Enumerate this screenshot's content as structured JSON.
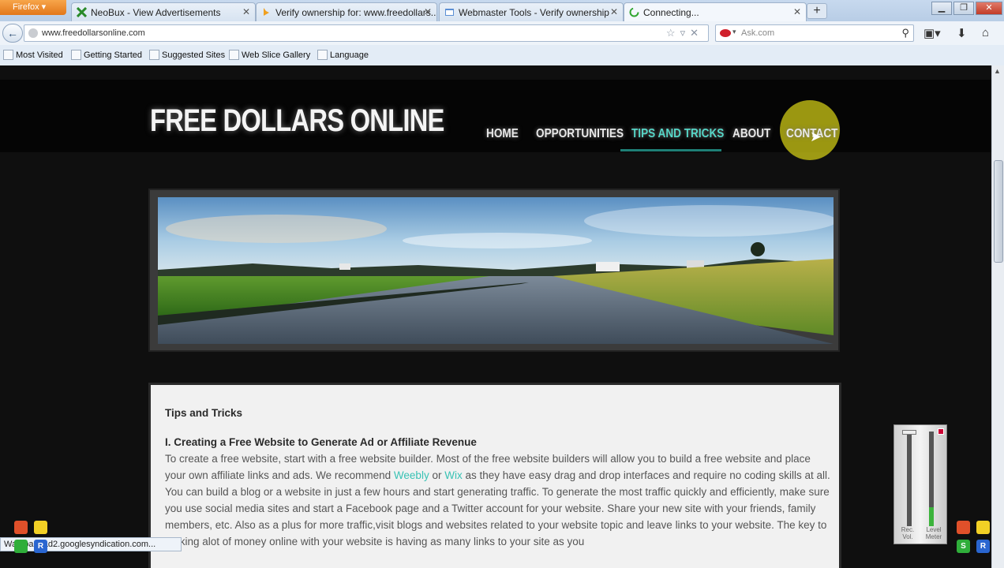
{
  "browser": {
    "app_button": "Firefox",
    "tabs": [
      {
        "title": "NeoBux - View Advertisements",
        "icon": "neobux-icon",
        "active": false
      },
      {
        "title": "Verify ownership for: www.freedollars...",
        "icon": "bing-icon",
        "active": false
      },
      {
        "title": "Webmaster Tools - Verify ownership",
        "icon": "webmaster-icon",
        "active": false
      },
      {
        "title": "Connecting...",
        "icon": "loading-icon",
        "active": true
      }
    ],
    "new_tab": "+",
    "url": "www.freedollarsonline.com",
    "search_placeholder": "Ask.com",
    "bookmarks": [
      "Most Visited",
      "Getting Started",
      "Suggested Sites",
      "Web Slice Gallery",
      "Language"
    ],
    "status_text": "Wa...pagead2.googlesyndication.com..."
  },
  "site": {
    "title": "FREE DOLLARS ONLINE",
    "nav": [
      {
        "label": "HOME",
        "active": false
      },
      {
        "label": "OPPORTUNITIES",
        "active": false
      },
      {
        "label": "TIPS AND TRICKS",
        "active": true
      },
      {
        "label": "ABOUT",
        "active": false
      },
      {
        "label": "CONTACT",
        "active": false
      }
    ],
    "accent_color": "#56d6c7",
    "content": {
      "heading": "Tips and Tricks",
      "section_title": "I. Creating a Free Website to Generate Ad or Affiliate Revenue",
      "text_before_links": "To create a free website, start with a free website builder. Most of the free website builders will allow you to build a free website and place your own affiliate links and ads. We recommend",
      "link_1": "Weebly",
      "text_between_links": "or",
      "link_2": "Wix",
      "text_after_links": "as they have easy drag and drop interfaces and require no coding skills at all. You can build a blog or a website in just a few hours and start generating traffic. To generate the most traffic quickly and efficiently, make sure you use social media sites and start a Facebook page and a Twitter account for your website. Share your new site with your friends, family members, etc. Also as a plus for more traffic,visit blogs and websites related to your website topic and leave links to your website. The key to making alot of money online with your website is having as many links to your site as you"
    }
  },
  "recorder": {
    "rec_label": "Rec. Vol.",
    "level_label": "Level Meter"
  }
}
